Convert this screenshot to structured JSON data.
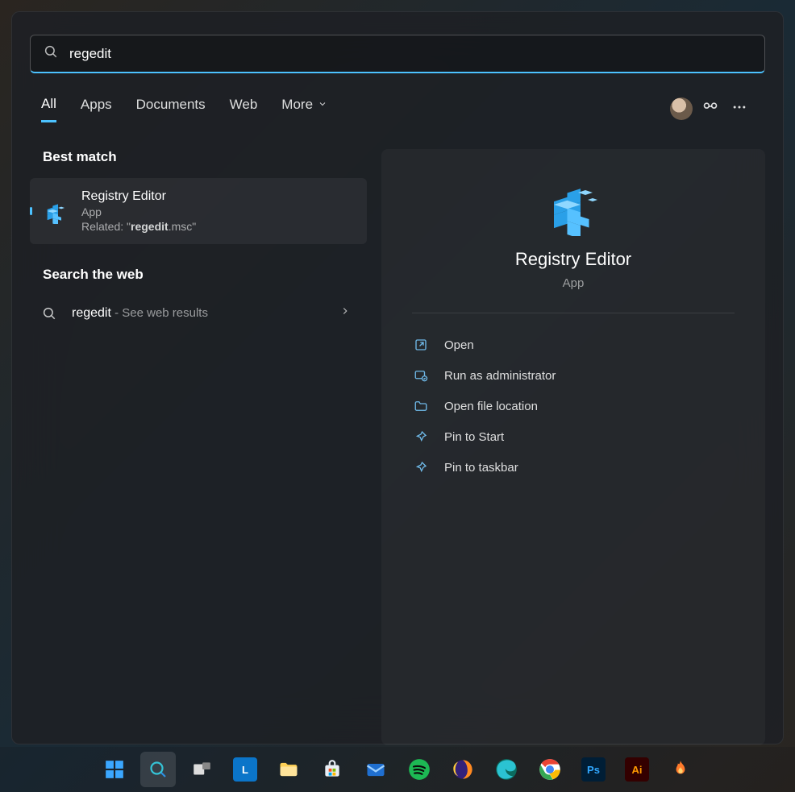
{
  "search": {
    "value": "regedit"
  },
  "tabs": {
    "all": "All",
    "apps": "Apps",
    "documents": "Documents",
    "web": "Web",
    "more": "More"
  },
  "left": {
    "best_match_heading": "Best match",
    "result": {
      "title": "Registry Editor",
      "subtitle": "App",
      "related_label": "Related: \"",
      "related_bold": "regedit",
      "related_after": ".msc\""
    },
    "web_heading": "Search the web",
    "web_item": {
      "term": "regedit",
      "hint": " - See web results"
    }
  },
  "preview": {
    "title": "Registry Editor",
    "subtitle": "App",
    "actions": {
      "open": "Open",
      "admin": "Run as administrator",
      "location": "Open file location",
      "pin_start": "Pin to Start",
      "pin_taskbar": "Pin to taskbar"
    }
  },
  "taskbar": {
    "items": [
      {
        "name": "start",
        "bg": "transparent"
      },
      {
        "name": "search",
        "bg": "transparent"
      },
      {
        "name": "taskview",
        "bg": "transparent"
      },
      {
        "name": "app-l",
        "bg": "#0b75c9",
        "letter": "L"
      },
      {
        "name": "explorer",
        "bg": "transparent"
      },
      {
        "name": "store",
        "bg": "transparent"
      },
      {
        "name": "mail",
        "bg": "transparent"
      },
      {
        "name": "spotify",
        "bg": "#1db954"
      },
      {
        "name": "firefox",
        "bg": "transparent"
      },
      {
        "name": "edge",
        "bg": "transparent"
      },
      {
        "name": "chrome",
        "bg": "transparent"
      },
      {
        "name": "photoshop",
        "bg": "#001e36",
        "letter": "Ps",
        "fg": "#31a8ff"
      },
      {
        "name": "illustrator",
        "bg": "#330000",
        "letter": "Ai",
        "fg": "#ff9a00"
      },
      {
        "name": "app-flame",
        "bg": "transparent"
      }
    ]
  }
}
